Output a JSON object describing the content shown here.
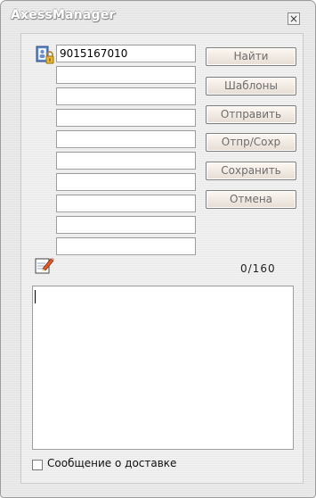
{
  "window": {
    "title": "AxessManager",
    "close_label": "×"
  },
  "recipients": {
    "fields": [
      "9015167010",
      "",
      "",
      "",
      "",
      "",
      "",
      "",
      "",
      ""
    ]
  },
  "buttons": {
    "find": "Найти",
    "templates": "Шаблоны",
    "send": "Отправить",
    "send_save": "Отпр/Сохр",
    "save": "Сохранить",
    "cancel": "Отмена"
  },
  "counter": {
    "text": "0/160"
  },
  "message": {
    "value": ""
  },
  "delivery_report": {
    "label": "Сообщение о доставке",
    "checked": false
  },
  "icons": {
    "contact": "contact-book-icon",
    "edit": "edit-note-icon"
  }
}
